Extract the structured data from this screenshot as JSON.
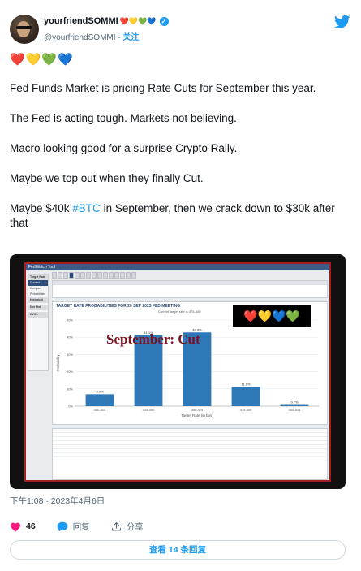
{
  "author": {
    "display_name": "yourfriendSOMMI",
    "name_emojis": "❤️💛💚💙",
    "handle": "@yourfriendSOMMI",
    "separator": "·",
    "follow_label": "关注"
  },
  "tweet": {
    "emoji_line": "❤️💛💚💙",
    "paragraphs": [
      "Fed Funds Market is pricing Rate Cuts for September this year.",
      "The Fed is acting tough. Markets not believing.",
      "Macro looking good for a surprise Crypto Rally.",
      "Maybe we top out when they finally Cut."
    ],
    "last_paragraph": {
      "before": "Maybe $40k ",
      "hashtag": "#BTC",
      "after": " in September, then we crack down to $30k after that"
    },
    "timestamp": "下午1:08 · 2023年4月6日"
  },
  "media": {
    "app_title": "FedWatch Tool",
    "overlay_text": "September: Cut",
    "overlay_hearts": "❤️💛💙💚",
    "sidebar": [
      "Target Rate",
      "Current",
      "Compare",
      "Probabilities",
      "Historical",
      "Dot Plot",
      "CVOL"
    ],
    "chart_title": "TARGET RATE PROBABILITIES FOR 20 SEP 2023 FED MEETING",
    "chart_subtitle": "Current target rate is 475-500",
    "chart_data": {
      "type": "bar",
      "categories": [
        "400-425",
        "425-450",
        "450-475",
        "475-500",
        "500-525"
      ],
      "values": [
        6.9,
        41.1,
        42.8,
        11.0,
        0.7
      ],
      "value_labels": [
        "6.9%",
        "41.1%",
        "42.8%",
        "11.0%",
        "0.7%"
      ],
      "xlabel": "Target Rate (in bps)",
      "ylabel": "Probability",
      "yticks": [
        "0%",
        "10%",
        "20%",
        "30%",
        "40%",
        "50%"
      ],
      "ylim": [
        0,
        50
      ],
      "bar_color": "#2f78b7"
    }
  },
  "actions": {
    "like_count": "46",
    "reply_label": "回复",
    "share_label": "分享"
  },
  "replies_button": "查看 14 条回复",
  "colors": {
    "accent": "#1d9bf0",
    "like": "#f91880",
    "overlay_red": "#7d1020"
  }
}
